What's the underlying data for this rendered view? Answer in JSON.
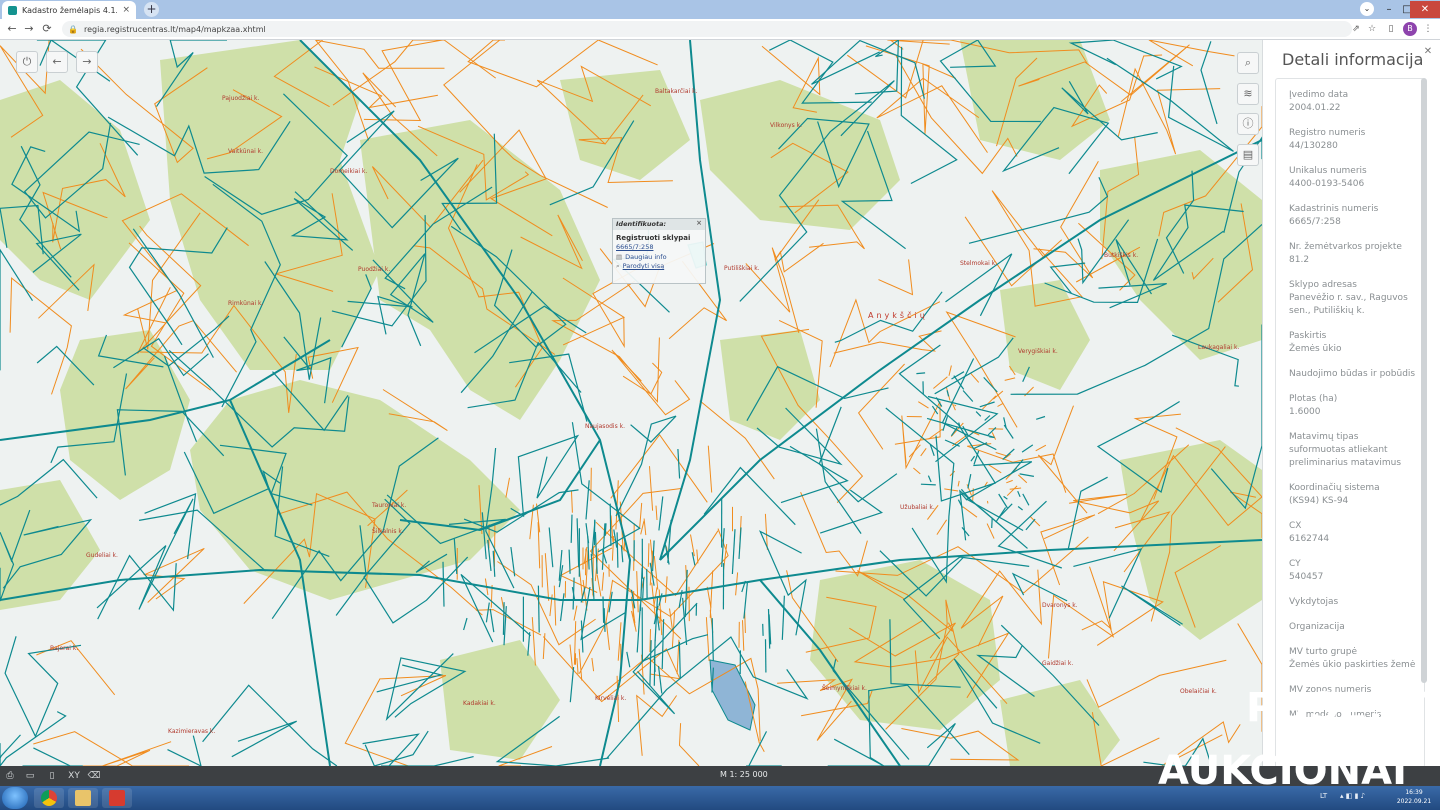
{
  "browser": {
    "tab_title": "Kadastro žemėlapis 4.1.25",
    "tab_close": "×",
    "new_tab": "+",
    "tab_menu": "⌄",
    "url": "regia.registrucentras.lt/map4/mapkzaa.xhtml",
    "back_icon": "arrow-left-icon",
    "forward_icon": "arrow-right-icon",
    "reload_icon": "reload-icon",
    "profile_initial": "B",
    "window_controls": [
      "–",
      "□",
      "✕"
    ]
  },
  "map": {
    "zoom_scale": "M 1: 25 000",
    "left_tools": [
      "power-icon",
      "back-icon",
      "forward-icon"
    ],
    "right_tools": [
      "search-icon",
      "layers-icon",
      "info-icon",
      "list-icon"
    ],
    "labels": {
      "town": "Anykščių",
      "villages": [
        "Pajuodžiai k.",
        "Domeikiai k.",
        "Vaitkūnai k.",
        "Puodžiai k.",
        "Baltakarčiai k.",
        "Rimkūnai k.",
        "Šilkalnis k.",
        "Naujasodis k.",
        "Tauroniai k.",
        "Gudeliai k.",
        "Vilkonys k.",
        "Bajorai k.",
        "Kazimieravas k.",
        "Putiliškiai k.",
        "Stelmokai k.",
        "Butkiškis k.",
        "Verygiškiai k.",
        "Laukagaliai k.",
        "Užubaliai k.",
        "Gaidžiai k.",
        "Šeimyniškiai k.",
        "Kadakiai k.",
        "Kirvėliai k.",
        "Dvaronys k.",
        "Obelaičiai k."
      ]
    },
    "popup": {
      "header": "Identifikuota:",
      "close": "×",
      "layer_title": "Registruoti sklypai",
      "parcel": "6665/7:258",
      "action_more": "Daugiau info",
      "action_show": "Parodyti visą"
    },
    "colors": {
      "parcel_teal": "#0e8a8f",
      "parcel_orange": "#f08c1e",
      "forest_green": "#cfe0a9",
      "background": "#eef2f1"
    }
  },
  "panel": {
    "title": "Detali informacija",
    "close": "✕",
    "fields": [
      {
        "label": "Įvedimo data",
        "value": "2004.01.22"
      },
      {
        "label": "Registro numeris",
        "value": "44/130280"
      },
      {
        "label": "Unikalus numeris",
        "value": "4400-0193-5406"
      },
      {
        "label": "Kadastrinis numeris",
        "value": "6665/7:258"
      },
      {
        "label": "Nr. žemėtvarkos projekte",
        "value": "81.2"
      },
      {
        "label": "Sklypo adresas",
        "value": "Panevėžio r. sav., Raguvos sen., Putiliškių k."
      },
      {
        "label": "Paskirtis",
        "value": "Žemės ūkio"
      },
      {
        "label": "Naudojimo būdas ir pobūdis",
        "value": ""
      },
      {
        "label": "Plotas (ha)",
        "value": "1.6000"
      },
      {
        "label": "Matavimų tipas",
        "value": "suformuotas atliekant preliminarius matavimus"
      },
      {
        "label": "Koordinačių sistema",
        "value": "(KS94) KS-94"
      },
      {
        "label": "CX",
        "value": "6162744"
      },
      {
        "label": "CY",
        "value": "540457"
      },
      {
        "label": "Vykdytojas",
        "value": ""
      },
      {
        "label": "Organizacija",
        "value": ""
      },
      {
        "label": "MV turto grupė",
        "value": "Žemės ūkio paskirties žemė"
      },
      {
        "label": "MV zonos numeris",
        "value": ""
      },
      {
        "label": "MV modelio numeris",
        "value": ""
      }
    ]
  },
  "statusbar": {
    "tools": [
      "printer-icon",
      "ruler-icon",
      "document-icon",
      "xy-icon",
      "eraser-icon"
    ],
    "xy_label": "XY"
  },
  "taskbar": {
    "apps": [
      "chrome-icon",
      "explorer-icon",
      "pdf-icon"
    ],
    "lang": "LT",
    "time": "16:39",
    "date": "2022.09.21"
  },
  "watermark": {
    "line1": "PUSE.LT",
    "line2": "AUKCIONAI"
  }
}
